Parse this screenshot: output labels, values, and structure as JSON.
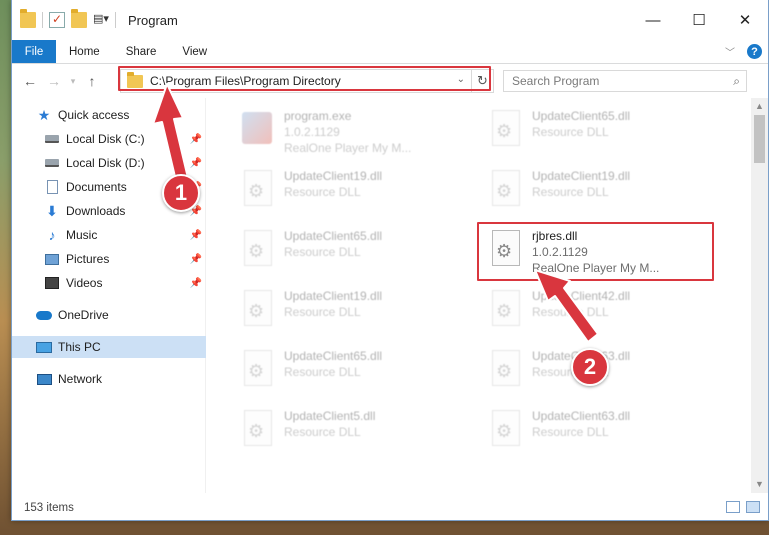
{
  "window": {
    "title": "Program",
    "controls": {
      "minimize": "—",
      "maximize": "☐",
      "close": "✕"
    }
  },
  "ribbon": {
    "tabs": [
      "File",
      "Home",
      "Share",
      "View"
    ],
    "help": "?"
  },
  "nav": {
    "back": "←",
    "forward": "→",
    "up": "↑",
    "address": "C:\\Program Files\\Program Directory",
    "search_placeholder": "Search Program"
  },
  "sidebar": {
    "items": [
      {
        "label": "Quick access",
        "icon": "star-icon",
        "pinned": false
      },
      {
        "label": "Local Disk (C:)",
        "icon": "drive-icon",
        "pinned": true
      },
      {
        "label": "Local Disk (D:)",
        "icon": "drive-icon",
        "pinned": true
      },
      {
        "label": "Documents",
        "icon": "documents-icon",
        "pinned": true
      },
      {
        "label": "Downloads",
        "icon": "downloads-icon",
        "pinned": true
      },
      {
        "label": "Music",
        "icon": "music-icon",
        "pinned": true
      },
      {
        "label": "Pictures",
        "icon": "pictures-icon",
        "pinned": true
      },
      {
        "label": "Videos",
        "icon": "videos-icon",
        "pinned": true
      },
      {
        "label": "OneDrive",
        "icon": "onedrive-icon",
        "pinned": false
      },
      {
        "label": "This PC",
        "icon": "this-pc-icon",
        "pinned": false,
        "selected": true
      },
      {
        "label": "Network",
        "icon": "network-icon",
        "pinned": false
      }
    ]
  },
  "files": [
    {
      "name": "program.exe",
      "line2": "1.0.2.1129",
      "line3": "RealOne Player My M...",
      "type": "exe",
      "faded": true
    },
    {
      "name": "UpdateClient65.dll",
      "line2": "Resource DLL",
      "type": "dll",
      "faded": true
    },
    {
      "name": "UpdateClient19.dll",
      "line2": "Resource DLL",
      "type": "dll",
      "faded": true
    },
    {
      "name": "UpdateClient19.dll",
      "line2": "Resource DLL",
      "type": "dll",
      "faded": true
    },
    {
      "name": "UpdateClient65.dll",
      "line2": "Resource DLL",
      "type": "dll",
      "faded": true
    },
    {
      "name": "rjbres.dll",
      "line2": "1.0.2.1129",
      "line3": "RealOne Player My M...",
      "type": "dll",
      "faded": false
    },
    {
      "name": "UpdateClient19.dll",
      "line2": "Resource DLL",
      "type": "dll",
      "faded": true
    },
    {
      "name": "UpdateClient42.dll",
      "line2": "Resource DLL",
      "type": "dll",
      "faded": true
    },
    {
      "name": "UpdateClient65.dll",
      "line2": "Resource DLL",
      "type": "dll",
      "faded": true
    },
    {
      "name": "UpdateClient63.dll",
      "line2": "Resource DLL",
      "type": "dll",
      "faded": true
    },
    {
      "name": "UpdateClient5.dll",
      "line2": "Resource DLL",
      "type": "dll",
      "faded": true
    },
    {
      "name": "UpdateClient63.dll",
      "line2": "Resource DLL",
      "type": "dll",
      "faded": true
    }
  ],
  "status": {
    "items": "153 items"
  },
  "annotations": {
    "step1": "1",
    "step2": "2",
    "color": "#d9363e"
  }
}
